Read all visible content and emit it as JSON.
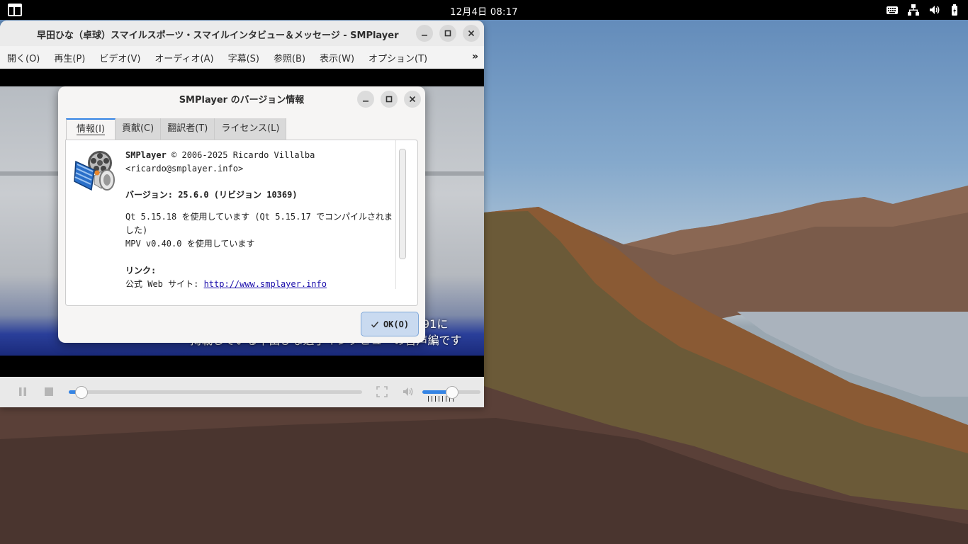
{
  "topbar": {
    "clock": "12月4日 08:17",
    "tray_icons": [
      "keyboard-icon",
      "network-icon",
      "volume-icon",
      "battery-icon"
    ]
  },
  "player": {
    "title": "早田ひな（卓球）スマイルスポーツ・スマイルインタビュー＆メッセージ - SMPlayer",
    "menu": [
      {
        "label": "開く(O)"
      },
      {
        "label": "再生(P)"
      },
      {
        "label": "ビデオ(V)"
      },
      {
        "label": "オーディオ(A)"
      },
      {
        "label": "字幕(S)"
      },
      {
        "label": "参照(B)"
      },
      {
        "label": "表示(W)"
      },
      {
        "label": "オプション(T)"
      }
    ],
    "menu_more": "»",
    "subtitle_line1": "91に",
    "subtitle_line2": "掲載している早田ひな選手インタビューの音声編です",
    "seek_progress": 0.04,
    "volume_level": 0.5
  },
  "about": {
    "title": "SMPlayer のバージョン情報",
    "tabs": [
      {
        "label": "情報(I)"
      },
      {
        "label": "貢献(C)"
      },
      {
        "label": "翻訳者(T)"
      },
      {
        "label": "ライセンス(L)"
      }
    ],
    "app_name": "SMPlayer",
    "copyright": "© 2006-2025 Ricardo Villalba",
    "email": "<ricardo@smplayer.info>",
    "version": "バージョン: 25.6.0 (リビジョン 10369)",
    "qt_line1": "Qt 5.15.18 を使用しています (Qt 5.15.17 でコンパイルされま",
    "qt_line2": "した)",
    "mpv": "MPV v0.40.0 を使用しています",
    "links_heading": "リンク:",
    "website_label": "公式 Web サイト: ",
    "website_url": "http://www.smplayer.info",
    "ok_label": "OK(O)"
  },
  "colors": {
    "accent": "#3584e4",
    "topbar": "#000000"
  }
}
